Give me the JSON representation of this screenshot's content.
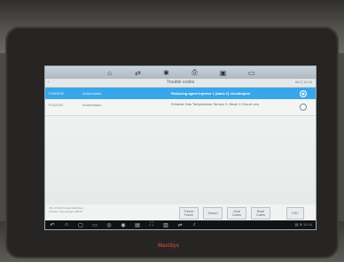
{
  "toolbar": {
    "icons": [
      "home-icon",
      "switch-icon",
      "settings-icon",
      "print-icon",
      "save-icon",
      "chat-icon"
    ],
    "glyphs": [
      "⌂",
      "⇄",
      "✱",
      "⎙",
      "▣",
      "▭"
    ]
  },
  "header": {
    "back": "‹",
    "title": "Trouble codes",
    "status": "Wi ▯ 12:14"
  },
  "codes": [
    {
      "code": "P20EE00",
      "state": "Active/static",
      "description": "Reducing agent injector 1 (bank 1) circuit/open",
      "selected": true
    },
    {
      "code": "P242000",
      "state": "Active/static",
      "description": "Exhaust Gas Temperature Sensor 3, Bank 1 Circuit Low",
      "selected": false
    }
  ],
  "footer": {
    "info_lines": [
      "VIN: 4VHNX (Autel MaxiSys)",
      "Vehicle: Volvo Engine MD13"
    ],
    "buttons": {
      "freeze_frame": "Freeze Frame",
      "search": "Search",
      "clear_codes": "Clear Codes",
      "read_codes": "Read Codes",
      "esc": "ESC"
    }
  },
  "navbar": {
    "icons": [
      "back-icon",
      "home-icon",
      "recent-apps-icon",
      "car-icon",
      "browser-icon",
      "camera-icon",
      "gallery-icon",
      "screenshot-icon",
      "vci-icon",
      "connection-icon",
      "volume-icon"
    ],
    "glyphs": [
      "↶",
      "⌂",
      "▢",
      "▭",
      "◎",
      "◉",
      "▤",
      "⛶",
      "▥",
      "⇌",
      "♪"
    ],
    "status": "▤ ⊕ 12:14"
  },
  "device": {
    "brand": "MaxiSys"
  }
}
